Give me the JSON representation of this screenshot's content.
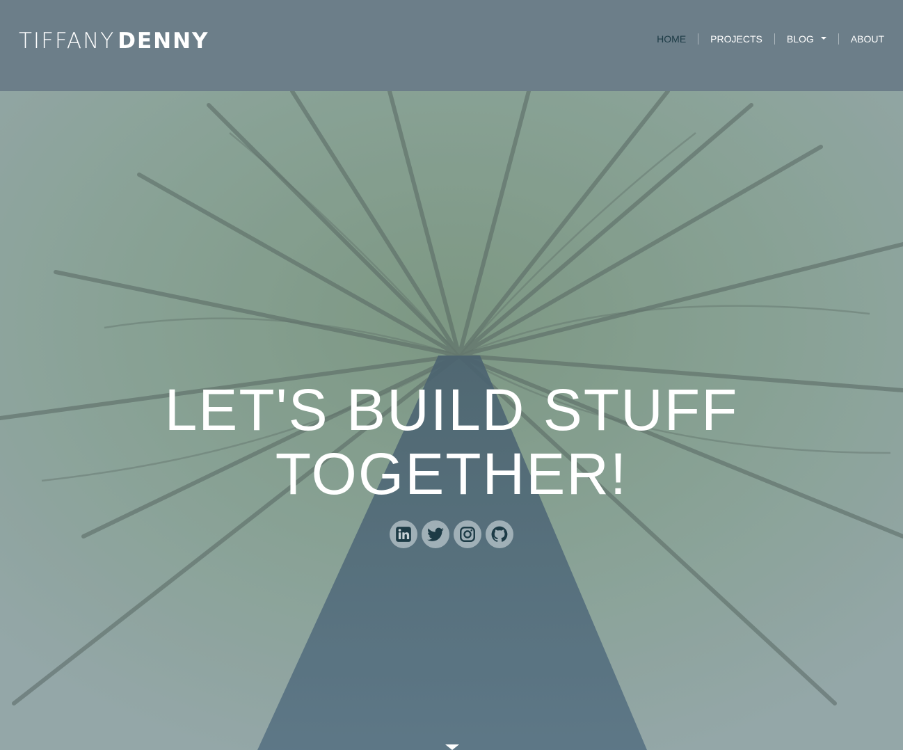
{
  "brand": {
    "first": "TIFFANY",
    "last": "DENNY"
  },
  "nav": {
    "items": [
      {
        "label": "HOME"
      },
      {
        "label": "PROJECTS"
      },
      {
        "label": "BLOG"
      },
      {
        "label": "ABOUT"
      }
    ]
  },
  "hero": {
    "line1": "LET'S BUILD STUFF",
    "line2": "TOGETHER!"
  },
  "social": [
    {
      "icon": "linkedin-icon"
    },
    {
      "icon": "twitter-icon"
    },
    {
      "icon": "instagram-icon"
    },
    {
      "icon": "github-icon"
    }
  ],
  "colors": {
    "header_bg": "#6c7e89",
    "nav_active": "#1d3b46",
    "icon_dark": "#1d3b46",
    "text_light": "#ffffff"
  }
}
